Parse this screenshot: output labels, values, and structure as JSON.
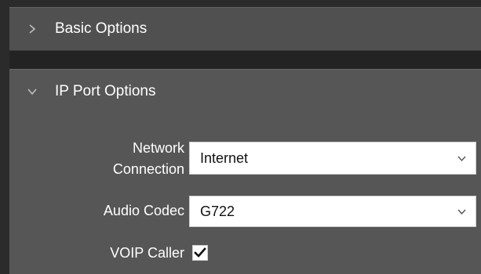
{
  "panels": {
    "basic": {
      "title": "Basic Options",
      "expanded": false
    },
    "ip_port": {
      "title": "IP Port Options",
      "expanded": true,
      "fields": {
        "network_connection": {
          "label_line1": "Network",
          "label_line2": "Connection",
          "value": "Internet"
        },
        "audio_codec": {
          "label": "Audio Codec",
          "value": "G722"
        },
        "voip_caller": {
          "label": "VOIP Caller",
          "checked": true
        }
      }
    }
  },
  "icons": {
    "collapsed": "chevron-right-icon",
    "expanded": "chevron-down-icon",
    "dropdown": "chevron-down-icon",
    "check": "checkmark-icon"
  },
  "colors": {
    "panel": "#505050",
    "panel_open": "#565656",
    "background": "#2b2b2b",
    "text": "#ffffff"
  }
}
